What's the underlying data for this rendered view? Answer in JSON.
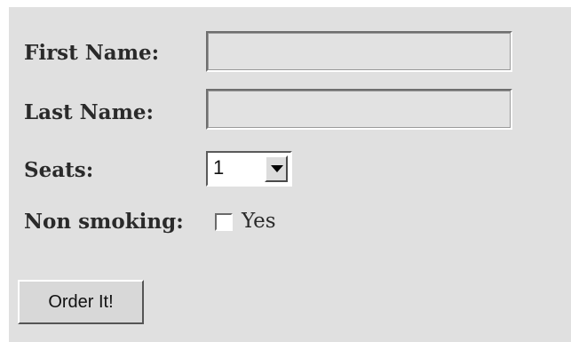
{
  "form": {
    "first_name": {
      "label": "First Name:",
      "value": ""
    },
    "last_name": {
      "label": "Last Name:",
      "value": ""
    },
    "seats": {
      "label": "Seats:",
      "selected": "1"
    },
    "non_smoking": {
      "label": "Non smoking:",
      "option_label": "Yes",
      "checked": false
    },
    "submit_label": "Order It!"
  },
  "colors": {
    "panel_background": "#e0e0e0",
    "page_background": "#ffffff"
  }
}
